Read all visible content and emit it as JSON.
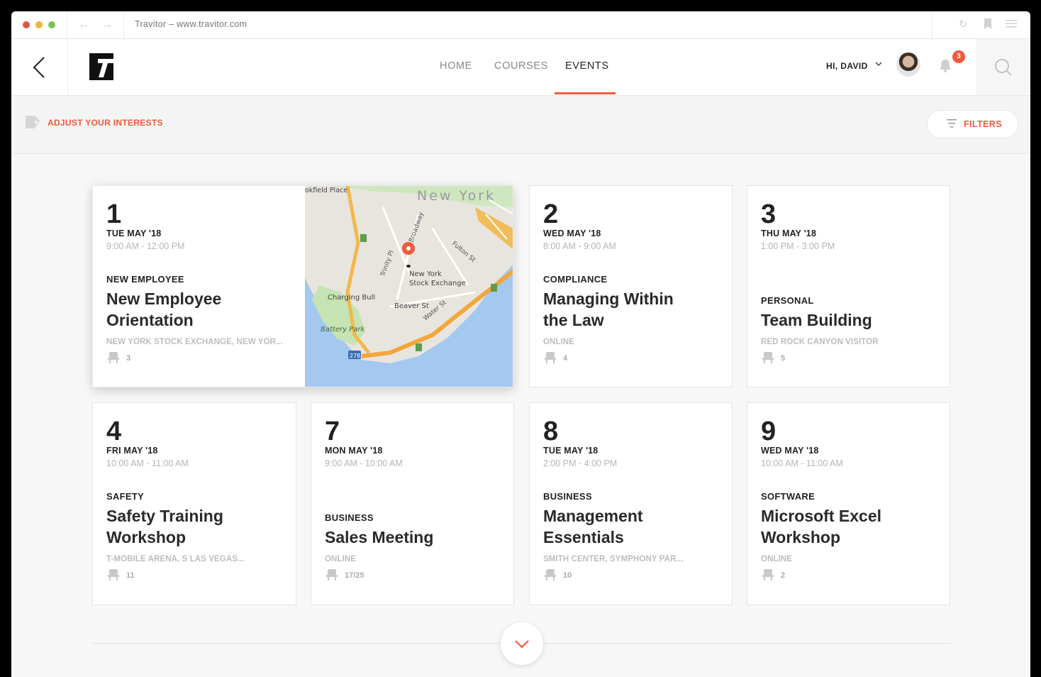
{
  "browser": {
    "url_text": "Travitor – www.travitor.com",
    "back_icon": "arrow-left-icon",
    "forward_icon": "arrow-right-icon"
  },
  "header": {
    "logo_text": "T",
    "nav": [
      {
        "label": "HOME",
        "active": false
      },
      {
        "label": "COURSES",
        "active": false
      },
      {
        "label": "EVENTS",
        "active": true
      }
    ],
    "greeting": "HI, DAVID",
    "notification_count": "3",
    "accent_color": "#ef5a3c"
  },
  "interests": {
    "adjust_label": "ADJUST YOUR INTERESTS",
    "filters_label": "FILTERS"
  },
  "events": [
    {
      "day": "1",
      "date": "TUE MAY '18",
      "time": "9:00 AM - 12:00 PM",
      "category": "NEW EMPLOYEE",
      "title": "New Employee Orientation",
      "location": "NEW YORK STOCK EXCHANGE, NEW YOR...",
      "count": "3"
    },
    {
      "day": "2",
      "date": "WED MAY '18",
      "time": "8:00 AM - 9:00 AM",
      "category": "COMPLIANCE",
      "title": "Managing Within the Law",
      "location": "ONLINE",
      "count": "4"
    },
    {
      "day": "3",
      "date": "THU MAY '18",
      "time": "1:00 PM - 3:00 PM",
      "category": "PERSONAL",
      "title": "Team Building",
      "location": "RED ROCK CANYON VISITOR",
      "count": "5"
    },
    {
      "day": "4",
      "date": "FRI MAY '18",
      "time": "10:00 AM - 11:00 AM",
      "category": "SAFETY",
      "title": "Safety Training Workshop",
      "location": "T-MOBILE ARENA, S LAS VEGAS...",
      "count": "11"
    },
    {
      "day": "7",
      "date": "MON MAY '18",
      "time": "9:00 AM - 10:00 AM",
      "category": "BUSINESS",
      "title": "Sales Meeting",
      "location": "ONLINE",
      "count": "17/25"
    },
    {
      "day": "8",
      "date": "TUE MAY '18",
      "time": "2:00 PM - 4:00 PM",
      "category": "BUSINESS",
      "title": "Management Essentials",
      "location": "SMITH CENTER, SYMPHONY PAR...",
      "count": "10"
    },
    {
      "day": "9",
      "date": "WED MAY '18",
      "time": "10:00 AM - 11:00 AM",
      "category": "SOFTWARE",
      "title": "Microsoft Excel Workshop",
      "location": "ONLINE",
      "count": "2"
    }
  ],
  "map": {
    "labels": {
      "city": "New York",
      "place_top": "okfield Place",
      "exchange_1": "New York",
      "exchange_2": "Stock Exchange",
      "bull": "Charging Bull",
      "beaver": "Beaver St",
      "battery": "Battery Park",
      "trinity": "Trinity Pl",
      "broadway": "Broadway",
      "fulton": "Fulton St",
      "water": "Water St",
      "highway": "278"
    }
  }
}
